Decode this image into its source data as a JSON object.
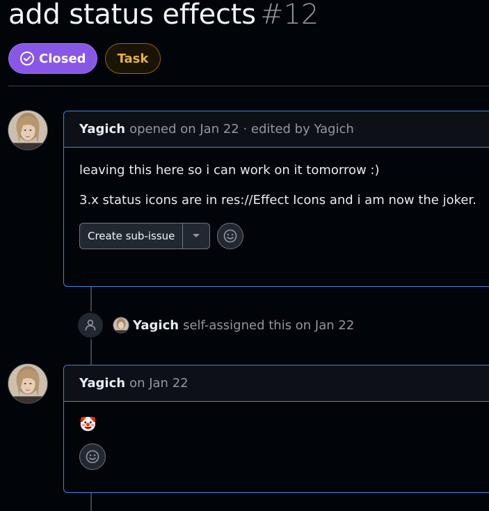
{
  "issue": {
    "title": "add status effects",
    "number": "#12"
  },
  "badges": {
    "state_label": "Closed",
    "type_label": "Task"
  },
  "colors": {
    "closed_badge": "#8957e5",
    "task_badge_text": "#e3b341",
    "comment_border": "#4184e4"
  },
  "comments": [
    {
      "author": "Yagich",
      "meta": "opened on Jan 22 · edited by Yagich",
      "paragraphs": [
        "leaving this here so i can work on it tomorrow :)",
        "3.x status icons are in res://Effect Icons and i am now the joker."
      ],
      "sub_issue_button": "Create sub-issue",
      "icons": [
        "check-circle-icon",
        "triangle-down-icon",
        "smiley-icon"
      ]
    },
    {
      "author": "Yagich",
      "meta": "on Jan 22",
      "emoji": "🤡",
      "icons": [
        "smiley-icon"
      ]
    }
  ],
  "event": {
    "author": "Yagich",
    "text": "self-assigned this on Jan 22",
    "icon": "person-icon"
  }
}
